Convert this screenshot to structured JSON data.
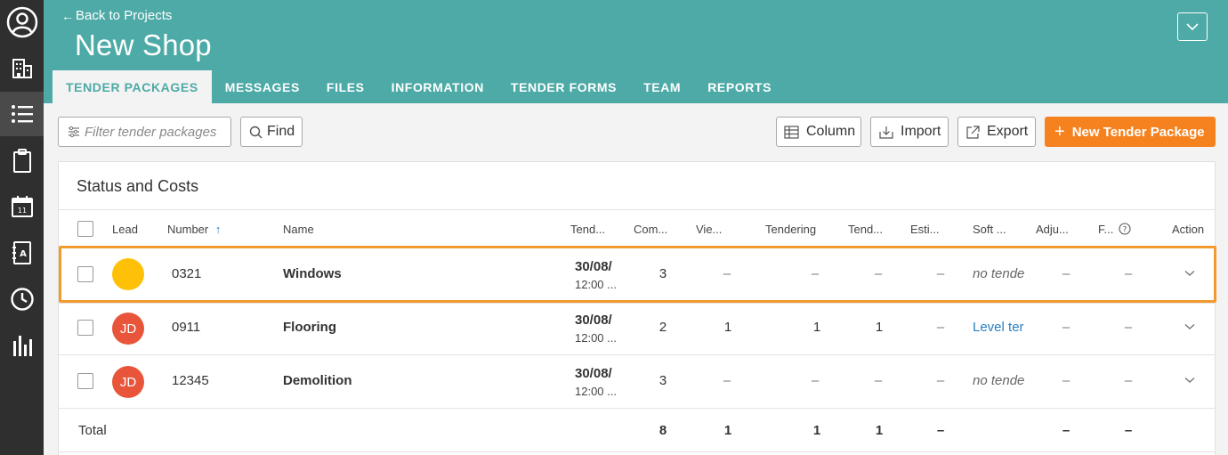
{
  "header": {
    "back_label": "Back to Projects",
    "project_title": "New Shop"
  },
  "tabs": [
    {
      "label": "TENDER PACKAGES",
      "active": true
    },
    {
      "label": "MESSAGES"
    },
    {
      "label": "FILES"
    },
    {
      "label": "INFORMATION"
    },
    {
      "label": "TENDER FORMS"
    },
    {
      "label": "TEAM"
    },
    {
      "label": "REPORTS"
    }
  ],
  "toolbar": {
    "filter_placeholder": "Filter tender packages",
    "find_label": "Find",
    "column_label": "Column",
    "import_label": "Import",
    "export_label": "Export",
    "new_label": "New Tender Package"
  },
  "card": {
    "title": "Status and Costs"
  },
  "columns": {
    "lead": "Lead",
    "number": "Number",
    "name": "Name",
    "tender": "Tend...",
    "com": "Com...",
    "vie": "Vie...",
    "tendering": "Tendering",
    "tend2": "Tend...",
    "esti": "Esti...",
    "soft": "Soft ...",
    "adju": "Adju...",
    "f": "F...",
    "action": "Action"
  },
  "rows": [
    {
      "lead": "",
      "lead_color": "#ffc107",
      "number": "0321",
      "name": "Windows",
      "date": "30/08/",
      "time": "12:00 ...",
      "com": "3",
      "vie": "–",
      "tendering": "–",
      "tend2": "–",
      "esti": "–",
      "soft": "no tende",
      "soft_style": "italic",
      "adju": "–",
      "f": "–"
    },
    {
      "lead": "JD",
      "lead_color": "#e8553a",
      "number": "0911",
      "name": "Flooring",
      "date": "30/08/",
      "time": "12:00 ...",
      "com": "2",
      "vie": "1",
      "tendering": "1",
      "tend2": "1",
      "esti": "–",
      "soft": "Level ter",
      "soft_style": "link",
      "adju": "–",
      "f": "–"
    },
    {
      "lead": "JD",
      "lead_color": "#e8553a",
      "number": "12345",
      "name": "Demolition",
      "date": "30/08/",
      "time": "12:00 ...",
      "com": "3",
      "vie": "–",
      "tendering": "–",
      "tend2": "–",
      "esti": "–",
      "soft": "no tende",
      "soft_style": "italic",
      "adju": "–",
      "f": "–"
    }
  ],
  "totals": {
    "label": "Total",
    "com": "8",
    "vie": "1",
    "tendering": "1",
    "tend2": "1",
    "esti": "–",
    "adju": "–",
    "f": "–"
  },
  "colors": {
    "header": "#4daaa6",
    "accent": "#f5821f",
    "highlight": "#f39a2e",
    "rail": "#2f2f2f"
  },
  "icons": {
    "rail": [
      "user-circle-icon",
      "building-icon",
      "list-icon",
      "clipboard-icon",
      "calendar-icon",
      "address-book-icon",
      "clock-icon",
      "bar-chart-icon"
    ]
  }
}
